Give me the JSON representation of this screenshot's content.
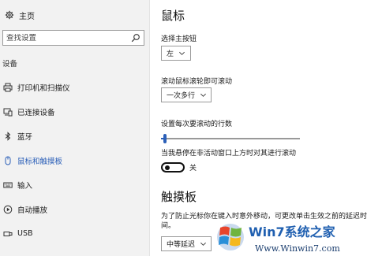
{
  "sidebar": {
    "home_label": "主页",
    "search_placeholder": "查找设置",
    "section_title": "设备",
    "items": [
      {
        "label": "打印机和扫描仪",
        "icon": "printer-icon"
      },
      {
        "label": "已连接设备",
        "icon": "connected-devices-icon"
      },
      {
        "label": "蓝牙",
        "icon": "bluetooth-icon"
      },
      {
        "label": "鼠标和触摸板",
        "icon": "mouse-icon",
        "active": true
      },
      {
        "label": "输入",
        "icon": "keyboard-icon"
      },
      {
        "label": "自动播放",
        "icon": "autoplay-icon"
      },
      {
        "label": "USB",
        "icon": "usb-icon"
      }
    ]
  },
  "main": {
    "mouse_title": "鼠标",
    "primary_button_label": "选择主按钮",
    "primary_button_value": "左",
    "scroll_label": "滚动鼠标滚轮即可滚动",
    "scroll_value": "一次多行",
    "lines_label": "设置每次要滚动的行数",
    "lines_slider_fraction": 0.02,
    "inactive_scroll_label": "当我悬停在非活动窗口上方时对其进行滚动",
    "inactive_scroll_state": "关",
    "touchpad_title": "触摸板",
    "touchpad_desc": "为了防止光标你在键入时意外移动，可更改单击生效之前的延迟时间。",
    "delay_value": "中等延迟"
  },
  "watermark": {
    "brand": "Win7系统之家",
    "url": "Www.Winwin7.com"
  },
  "colors": {
    "accent": "#2b5fb8",
    "sidebar_bg": "#f2f2f2"
  }
}
